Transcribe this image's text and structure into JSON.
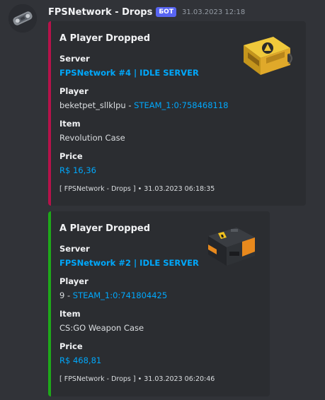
{
  "message": {
    "author": "FPSNetwork - Drops",
    "bot_tag": "БОТ",
    "timestamp": "31.03.2023 12:18",
    "avatar_icon": "gear-capsule-icon"
  },
  "embeds": [
    {
      "accent_color": "#b7124a",
      "title": "A Player Dropped",
      "server_label": "Server",
      "server_value": "FPSNetwork #4 | IDLE SERVER",
      "player_label": "Player",
      "player_name": "beketpet_sllklpu",
      "player_sep": " - ",
      "player_steam_id": "STEAM_1:0:758468118",
      "item_label": "Item",
      "item_value": "Revolution Case",
      "price_label": "Price",
      "price_value": "R$ 16,36",
      "footer": "[ FPSNetwork - Drops ] • 31.03.2023 06:18:35",
      "thumbnail_icon": "revolution-case-icon"
    },
    {
      "accent_color": "#1ea81a",
      "title": "A Player Dropped",
      "server_label": "Server",
      "server_value": "FPSNetwork #2 | IDLE SERVER",
      "player_label": "Player",
      "player_name": "9",
      "player_sep": " - ",
      "player_steam_id": "STEAM_1:0:741804425",
      "item_label": "Item",
      "item_value": "CS:GO Weapon Case",
      "price_label": "Price",
      "price_value": "R$ 468,81",
      "footer": "[ FPSNetwork - Drops ] • 31.03.2023 06:20:46",
      "thumbnail_icon": "weapon-case-icon"
    }
  ]
}
